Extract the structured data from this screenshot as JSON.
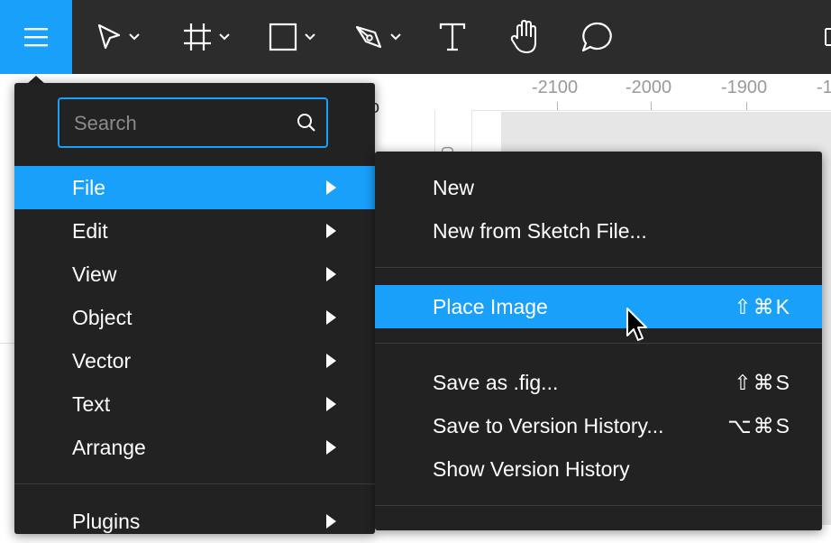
{
  "colors": {
    "accent": "#18a0fb",
    "toolbar": "#2c2c2c",
    "menu_bg": "#222222"
  },
  "toolbar": {
    "menu_icon": "hamburger-icon",
    "tools": [
      {
        "name": "move-tool",
        "icon": "pointer-icon",
        "has_dropdown": true
      },
      {
        "name": "frame-tool",
        "icon": "frame-icon",
        "has_dropdown": true
      },
      {
        "name": "shape-tool",
        "icon": "rectangle-icon",
        "has_dropdown": true
      },
      {
        "name": "pen-tool",
        "icon": "pen-icon",
        "has_dropdown": true
      },
      {
        "name": "text-tool",
        "icon": "text-icon",
        "has_dropdown": false
      },
      {
        "name": "hand-tool",
        "icon": "hand-icon",
        "has_dropdown": false
      },
      {
        "name": "comment-tool",
        "icon": "comment-icon",
        "has_dropdown": false
      }
    ]
  },
  "ruler": {
    "ticks": [
      "-2100",
      "-2000",
      "-1900",
      "-1"
    ],
    "left_tick": "00"
  },
  "background_hint": "o",
  "main_menu": {
    "search_placeholder": "Search",
    "items": [
      {
        "label": "File",
        "submenu": true,
        "active": true
      },
      {
        "label": "Edit",
        "submenu": true
      },
      {
        "label": "View",
        "submenu": true
      },
      {
        "label": "Object",
        "submenu": true
      },
      {
        "label": "Vector",
        "submenu": true
      },
      {
        "label": "Text",
        "submenu": true
      },
      {
        "label": "Arrange",
        "submenu": true
      },
      {
        "label": "Plugins",
        "submenu": true
      }
    ]
  },
  "file_menu": {
    "items": [
      {
        "label": "New",
        "shortcut": ""
      },
      {
        "label": "New from Sketch File...",
        "shortcut": ""
      },
      {
        "label": "Place Image",
        "shortcut": "⇧⌘K",
        "active": true
      },
      {
        "label": "Save as .fig...",
        "shortcut": "⇧⌘S"
      },
      {
        "label": "Save to Version History...",
        "shortcut": "⌥⌘S"
      },
      {
        "label": "Show Version History",
        "shortcut": ""
      }
    ]
  }
}
